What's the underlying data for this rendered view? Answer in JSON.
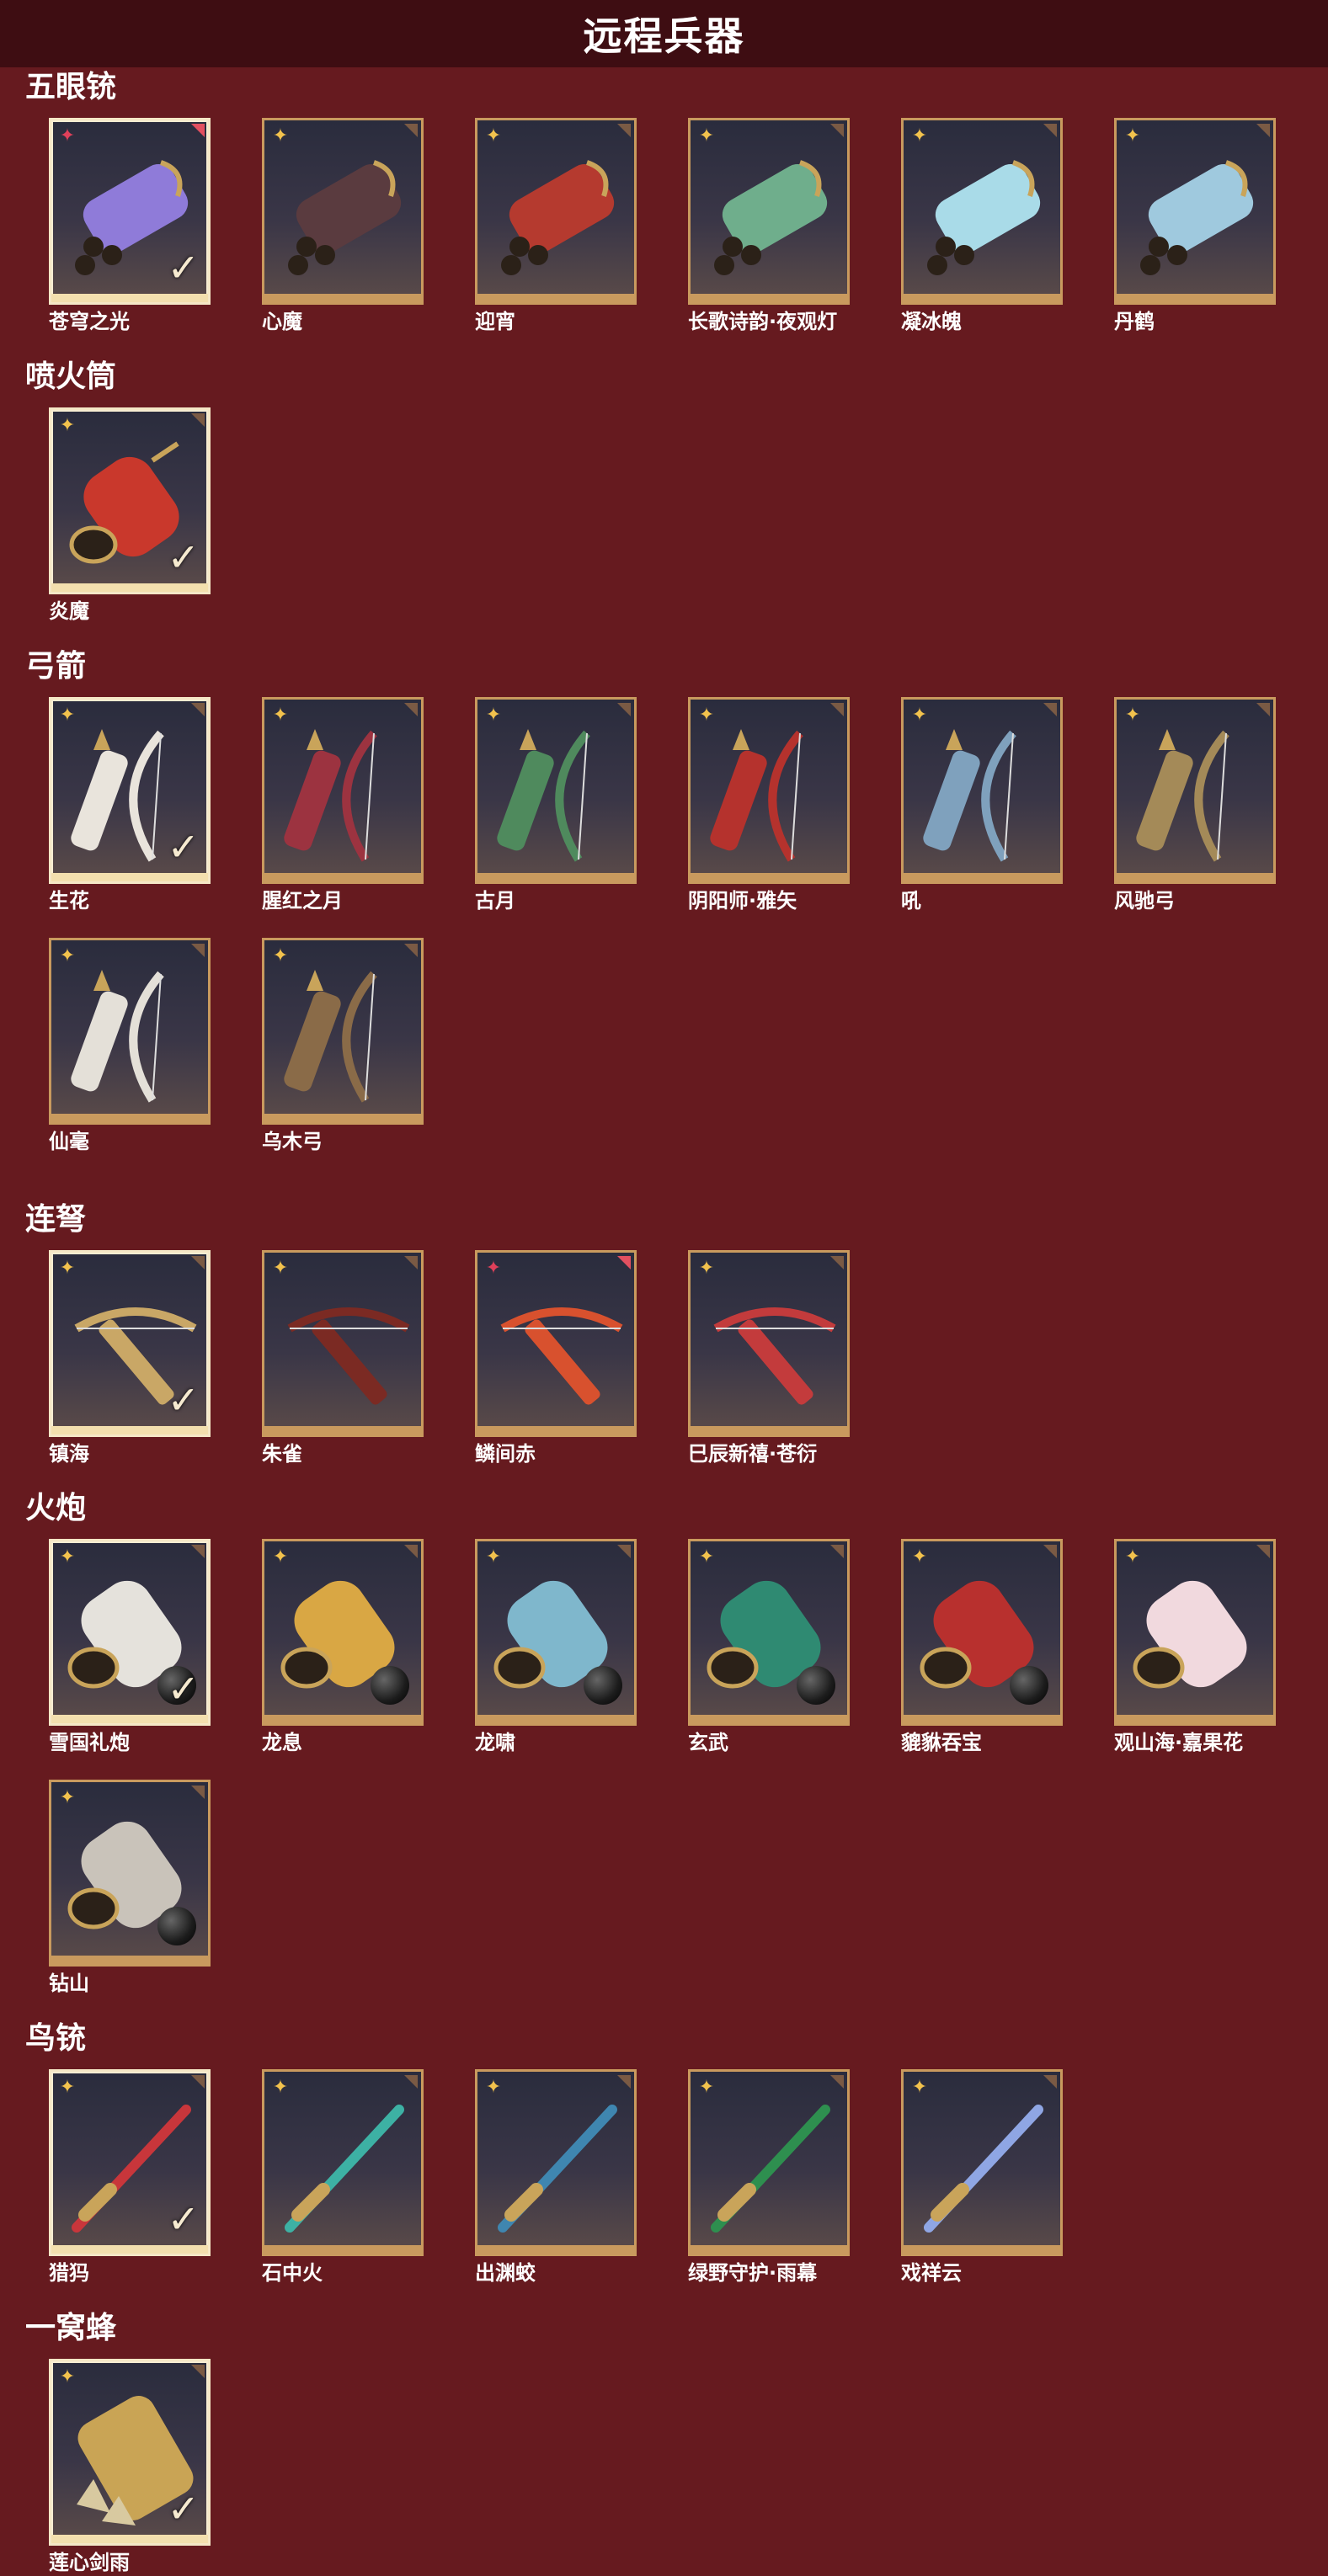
{
  "title": "远程兵器",
  "check_glyph": "✓",
  "rarity_glyph": "✦",
  "sections": [
    {
      "title": "五眼铳",
      "items": [
        {
          "name": "苍穹之光",
          "owned": true,
          "rarity": "red",
          "icon": "five-barrel-gun-icon",
          "color": "#8f7bd9"
        },
        {
          "name": "心魔",
          "owned": false,
          "rarity": "gold",
          "icon": "five-barrel-gun-icon",
          "color": "#5a3b3f"
        },
        {
          "name": "迎宵",
          "owned": false,
          "rarity": "gold",
          "icon": "five-barrel-gun-icon",
          "color": "#b53a2f"
        },
        {
          "name": "长歌诗韵·夜观灯",
          "owned": false,
          "rarity": "gold",
          "icon": "five-barrel-gun-icon",
          "color": "#6fae8c"
        },
        {
          "name": "凝冰魄",
          "owned": false,
          "rarity": "gold",
          "icon": "five-barrel-gun-icon",
          "color": "#a9dbe8"
        },
        {
          "name": "丹鹤",
          "owned": false,
          "rarity": "gold",
          "icon": "five-barrel-gun-icon",
          "color": "#9fc9de"
        }
      ]
    },
    {
      "title": "喷火筒",
      "items": [
        {
          "name": "炎魔",
          "owned": true,
          "rarity": "gold",
          "icon": "flamethrower-icon",
          "color": "#c9382c"
        }
      ]
    },
    {
      "title": "弓箭",
      "items": [
        {
          "name": "生花",
          "owned": true,
          "rarity": "gold",
          "icon": "bow-icon",
          "color": "#e9e4dc"
        },
        {
          "name": "腥红之月",
          "owned": false,
          "rarity": "gold",
          "icon": "bow-icon",
          "color": "#9c3340"
        },
        {
          "name": "古月",
          "owned": false,
          "rarity": "gold",
          "icon": "bow-icon",
          "color": "#4f8a5d"
        },
        {
          "name": "阴阳师·雅矢",
          "owned": false,
          "rarity": "gold",
          "icon": "bow-icon",
          "color": "#b5322d"
        },
        {
          "name": "吼",
          "owned": false,
          "rarity": "gold",
          "icon": "bow-icon",
          "color": "#7fa1bd"
        },
        {
          "name": "风驰弓",
          "owned": false,
          "rarity": "gold",
          "icon": "bow-icon",
          "color": "#a48a58"
        },
        {
          "name": "仙毫",
          "owned": false,
          "rarity": "gold",
          "icon": "bow-icon",
          "color": "#e4e0d8"
        },
        {
          "name": "乌木弓",
          "owned": false,
          "rarity": "gold",
          "icon": "bow-icon",
          "color": "#8a6b48"
        }
      ]
    },
    {
      "title": "连弩",
      "items": [
        {
          "name": "镇海",
          "owned": true,
          "rarity": "gold",
          "icon": "crossbow-icon",
          "color": "#c9a766"
        },
        {
          "name": "朱雀",
          "owned": false,
          "rarity": "gold",
          "icon": "crossbow-icon",
          "color": "#7b2a23"
        },
        {
          "name": "鳞间赤",
          "owned": false,
          "rarity": "red",
          "icon": "crossbow-icon",
          "color": "#d8512e"
        },
        {
          "name": "巳辰新禧·苍衍",
          "owned": false,
          "rarity": "gold",
          "icon": "crossbow-icon",
          "color": "#c33b3c"
        }
      ]
    },
    {
      "title": "火炮",
      "items": [
        {
          "name": "雪国礼炮",
          "owned": true,
          "rarity": "gold",
          "icon": "cannon-icon",
          "color": "#e5e2dc",
          "ball": true
        },
        {
          "name": "龙息",
          "owned": false,
          "rarity": "gold",
          "icon": "cannon-icon",
          "color": "#d9a744",
          "ball": true
        },
        {
          "name": "龙啸",
          "owned": false,
          "rarity": "gold",
          "icon": "cannon-icon",
          "color": "#7fb7cc",
          "ball": true
        },
        {
          "name": "玄武",
          "owned": false,
          "rarity": "gold",
          "icon": "cannon-icon",
          "color": "#2f8a72",
          "ball": true
        },
        {
          "name": "貔貅吞宝",
          "owned": false,
          "rarity": "gold",
          "icon": "cannon-icon",
          "color": "#b8302e",
          "ball": true
        },
        {
          "name": "观山海·嘉果花",
          "owned": false,
          "rarity": "gold",
          "icon": "cannon-icon",
          "color": "#f1d9de",
          "ball": false
        },
        {
          "name": "钻山",
          "owned": false,
          "rarity": "gold",
          "icon": "cannon-icon",
          "color": "#c9c3ba",
          "ball": true
        }
      ]
    },
    {
      "title": "鸟铳",
      "items": [
        {
          "name": "猎犸",
          "owned": true,
          "rarity": "gold",
          "icon": "musket-icon",
          "color": "#c8363b"
        },
        {
          "name": "石中火",
          "owned": false,
          "rarity": "gold",
          "icon": "musket-icon",
          "color": "#3db1a4"
        },
        {
          "name": "出渊蛟",
          "owned": false,
          "rarity": "gold",
          "icon": "musket-icon",
          "color": "#3f86b0"
        },
        {
          "name": "绿野守护·雨幕",
          "owned": false,
          "rarity": "gold",
          "icon": "musket-icon",
          "color": "#2e8f4f"
        },
        {
          "name": "戏祥云",
          "owned": false,
          "rarity": "gold",
          "icon": "musket-icon",
          "color": "#8fa6e4"
        }
      ]
    },
    {
      "title": "一窝蜂",
      "items": [
        {
          "name": "莲心剑雨",
          "owned": true,
          "rarity": "gold",
          "icon": "rocket-launcher-icon",
          "color": "#c9a455"
        }
      ]
    }
  ]
}
